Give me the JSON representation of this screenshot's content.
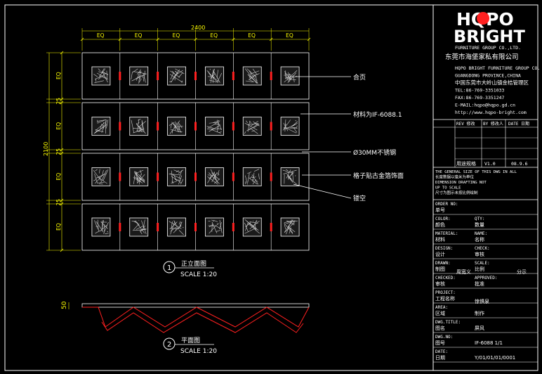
{
  "logo": {
    "line1": "HQPO",
    "line2": "BRIGHT",
    "subtitle": "FURNITURE GROUP CO.,LTD.",
    "company_cn": "东莞市海堡家私有限公司"
  },
  "dimensions": {
    "total_width": "2400",
    "total_height": "2100",
    "column_labels": [
      "EQ",
      "EQ",
      "EQ",
      "EQ",
      "EQ",
      "EQ"
    ],
    "row_labels": [
      "EQ",
      "25",
      "EQ",
      "25",
      "EQ",
      "25",
      "EQ"
    ],
    "plan_depth": "50"
  },
  "annotations": [
    "合页",
    "材料为IF-6088.1",
    "Ø30MM不锈钢",
    "格子贴古金箔饰面",
    "镂空"
  ],
  "views": [
    {
      "number": "1",
      "title": "正立面图",
      "scale": "SCALE 1:20"
    },
    {
      "number": "2",
      "title": "平面图",
      "scale": "SCALE 1:20"
    }
  ],
  "title_block": {
    "address_lines": [
      "HQPO BRIGHT FURNITURE GROUP CO.",
      "GUANGDONG PROVINCE,CHINA",
      "中国东莞市大岭山镇金桔管理区",
      "TEL:86-769-3351033",
      "FAX:86-769-3351247",
      "E-MAIL:hqpo@hqpo.gd.cn",
      "http://www.hqpo-bright.com"
    ],
    "revision_header": [
      "REV 修改",
      "BY 修改人",
      "DATE 日期"
    ],
    "rev_row": [
      "用途规格",
      "V1.0",
      "08.9.6"
    ],
    "notes": [
      "THE GENERAL SIZE OF THIS DWG IN ALL",
      "长度数据以毫米为单位",
      "DIMENSION DRAFTING NOT",
      "UP TO SCALE",
      "尺寸为图示未按比例绘制"
    ],
    "rows": [
      {
        "l1": "ORDER NO:",
        "r1": "",
        "l2": "单号",
        "r2": ""
      },
      {
        "l1": "COLOR:",
        "r1": "QTY:",
        "l2": "颜色",
        "r2": "数量"
      },
      {
        "l1": "MATERIAL:",
        "r1": "NAME:",
        "l2": "材料",
        "r2": "名称"
      },
      {
        "l1": "DESIGN:",
        "r1": "CHECK:",
        "l2": "设计",
        "r2": "审核"
      },
      {
        "l1": "DRAWN:",
        "r1": "SCALE:",
        "l2": "制图",
        "r2": "比例"
      },
      {
        "l1": "CHECKED:",
        "r1": "APPROVED:",
        "l2": "审核",
        "r2": "批准"
      },
      {
        "l1": "PROJECT:",
        "r1": "",
        "l2": "工程名称",
        "r2": ""
      },
      {
        "l1": "AREA:",
        "r1": "",
        "l2": "区域",
        "r2": "制作"
      },
      {
        "l1": "DWG.TITLE:",
        "r1": "",
        "l2": "图名",
        "r2": "屏风"
      },
      {
        "l1": "DWG.NO:",
        "r1": "",
        "l2": "图号",
        "r2": "IF-6088   1/1"
      },
      {
        "l1": "DATE:",
        "r1": "",
        "l2": "日期",
        "r2": "Y/01/01/01/0001"
      }
    ],
    "drawn_by_value": "周宽义",
    "scale_value": "分示",
    "project_value": "惊惧泉"
  },
  "colors": {
    "background": "#000000",
    "line": "#ffffff",
    "dim": "#ffff00",
    "hinge": "#ff2020",
    "plan": "#ff2020"
  }
}
